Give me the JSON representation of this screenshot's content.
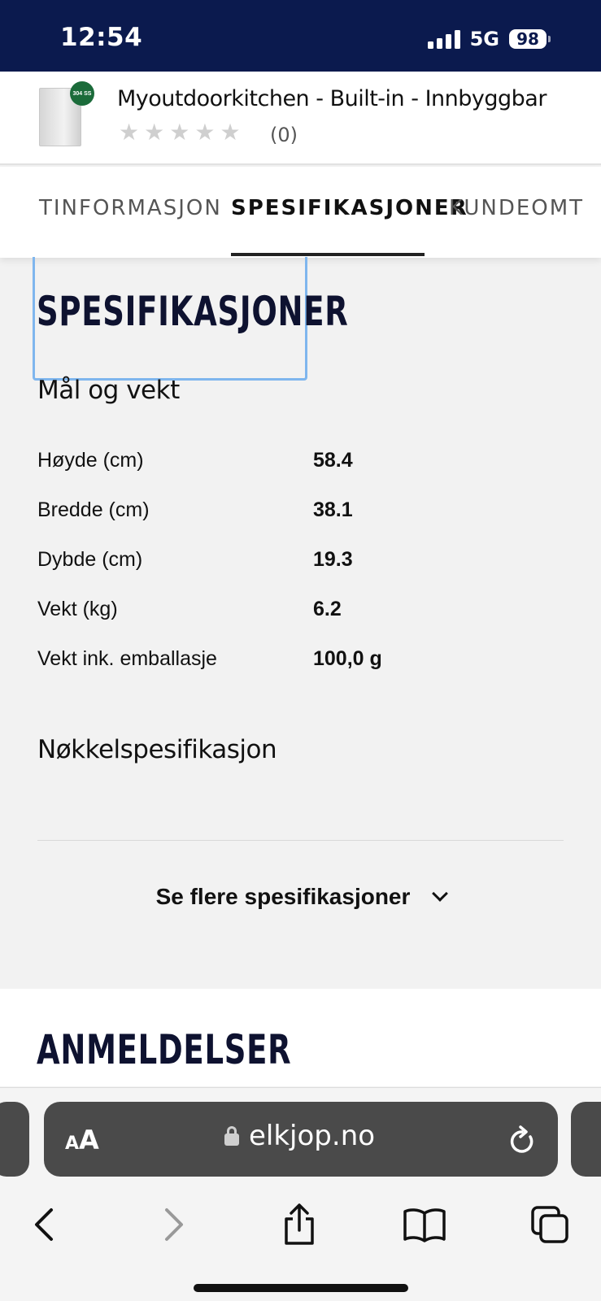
{
  "status_bar": {
    "time": "12:54",
    "network": "5G",
    "battery": "98"
  },
  "product": {
    "badge": "304 SS",
    "title": "Myoutdoorkitchen - Built-in - Innbyggbar",
    "stars": [
      "★",
      "★",
      "★",
      "★",
      "★"
    ],
    "review_count": "(0)"
  },
  "tabs": [
    {
      "label": "TINFORMASJON",
      "active": false
    },
    {
      "label": "SPESIFIKASJONER",
      "active": true
    },
    {
      "label": "KUNDEOMT",
      "active": false
    }
  ],
  "specs": {
    "heading": "SPESIFIKASJONER",
    "group1_title": "Mål og vekt",
    "rows": [
      {
        "label": "Høyde (cm)",
        "value": "58.4"
      },
      {
        "label": "Bredde (cm)",
        "value": "38.1"
      },
      {
        "label": "Dybde (cm)",
        "value": "19.3"
      },
      {
        "label": "Vekt (kg)",
        "value": "6.2"
      },
      {
        "label": "Vekt ink. emballasje",
        "value": "100,0 g"
      }
    ],
    "group2_title": "Nøkkelspesifikasjon",
    "more_label": "Se flere spesifikasjoner"
  },
  "reviews": {
    "heading": "ANMELDELSER"
  },
  "browser": {
    "aa_label_small": "A",
    "aa_label_large": "A",
    "url": "elkjop.no"
  }
}
